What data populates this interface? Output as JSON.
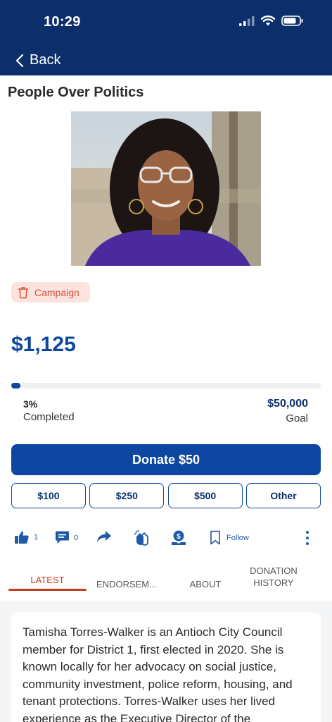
{
  "status_bar": {
    "time": "10:29"
  },
  "nav": {
    "back_label": "Back"
  },
  "page": {
    "title": "People Over Politics"
  },
  "badge": {
    "label": "Campaign"
  },
  "funding": {
    "raised": "$1,125",
    "percent_text": "3%",
    "percent_value": 0.03,
    "completed_label": "Completed",
    "goal": "$50,000",
    "goal_label": "Goal"
  },
  "donate": {
    "primary_label": "Donate $50",
    "amounts": [
      "$100",
      "$250",
      "$500",
      "Other"
    ]
  },
  "actions": {
    "like_count": "1",
    "comment_count": "0",
    "follow_label": "Follow"
  },
  "tabs": [
    {
      "label": "LATEST",
      "active": true
    },
    {
      "label": "ENDORSEM...",
      "active": false
    },
    {
      "label": "ABOUT",
      "active": false
    },
    {
      "label": "DONATION HISTORY",
      "active": false
    }
  ],
  "colors": {
    "header": "#0c2f6b",
    "primary": "#0d47a1",
    "accent": "#c43d1f",
    "badge_bg": "#fde2de"
  },
  "content": {
    "body": "Tamisha Torres-Walker is an Antioch City Council member for District 1, first elected in 2020. She is known locally for her advocacy on social justice, community investment, police reform, housing, and tenant protections. Torres-Walker uses her lived experience as the Executive Director of the"
  }
}
